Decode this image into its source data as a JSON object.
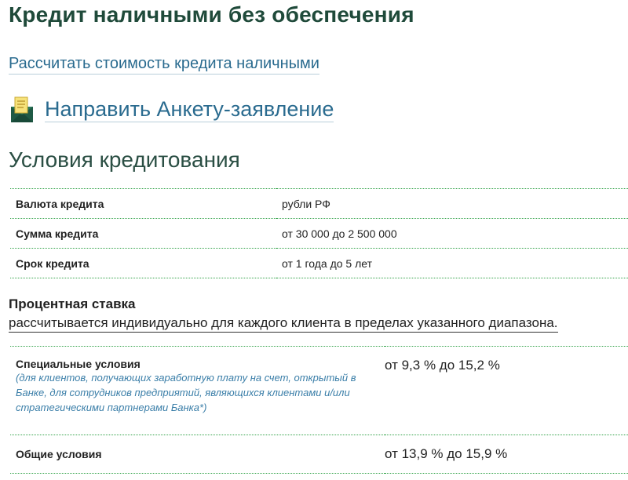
{
  "page": {
    "title": "Кредит наличными без обеспечения",
    "calc_link": "Рассчитать стоимость кредита наличными",
    "apply_link": "Направить Анкету-заявление",
    "apply_icon": "envelope-icon",
    "section_title": "Условия кредитования"
  },
  "terms": [
    {
      "label": "Валюта кредита",
      "value": "рубли РФ"
    },
    {
      "label": "Сумма кредита",
      "value": "от 30 000 до 2 500 000"
    },
    {
      "label": "Срок кредита",
      "value": "от 1 года до 5 лет"
    }
  ],
  "rate": {
    "heading": "Процентная ставка",
    "note": "рассчитывается индивидуально для каждого клиента в пределах указанного диапазона.",
    "rows": [
      {
        "label": "Специальные условия",
        "desc": "(для клиентов, получающих заработную плату на счет, открытый в Банке, для сотрудников предприятий, являющихся клиентами и/или стратегическими партнерами Банка*)",
        "value": "от 9,3 % до 15,2 %"
      },
      {
        "label": "Общие условия",
        "value": "от 13,9 % до 15,9 %"
      }
    ]
  },
  "colors": {
    "title": "#1f4a3a",
    "link": "#2a6b8f",
    "divider": "#33a34a",
    "italic_note": "#3a7ea8"
  }
}
